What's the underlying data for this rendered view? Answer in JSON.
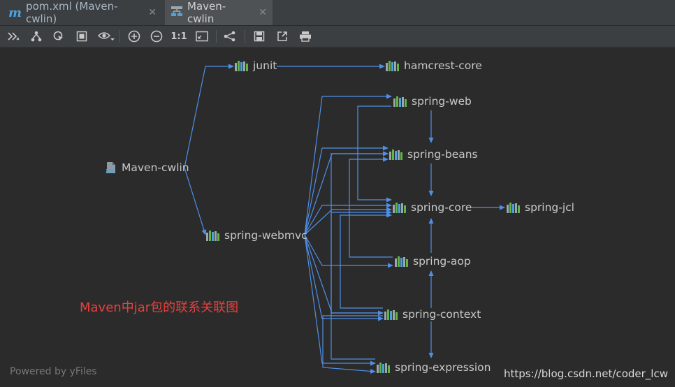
{
  "tabs": [
    {
      "label": "pom.xml (Maven-cwlin)",
      "icon": "maven-m-icon",
      "active": false
    },
    {
      "label": "Maven-cwlin",
      "icon": "diagram-icon",
      "active": true
    }
  ],
  "toolbar": {
    "actual_size_label": "1:1",
    "icons": [
      "collapse-icon",
      "hierarchy-icon",
      "navigate-icon",
      "fit-content-icon",
      "visibility-icon",
      "zoom-in-icon",
      "zoom-out-icon",
      "actual-size-icon",
      "fit-page-icon",
      "layout-icon",
      "save-icon",
      "export-icon",
      "print-icon"
    ]
  },
  "diagram": {
    "nodes": {
      "root": "Maven-cwlin",
      "junit": "junit",
      "hamcrest": "hamcrest-core",
      "webmvc": "spring-webmvc",
      "web": "spring-web",
      "beans": "spring-beans",
      "core": "spring-core",
      "jcl": "spring-jcl",
      "aop": "spring-aop",
      "context": "spring-context",
      "expression": "spring-expression"
    },
    "edge_color": "#4f8fe8",
    "caption": "Maven中jar包的联系关联图"
  },
  "footer": {
    "powered_by": "Powered by yFiles",
    "watermark": "https://blog.csdn.net/coder_lcw"
  }
}
